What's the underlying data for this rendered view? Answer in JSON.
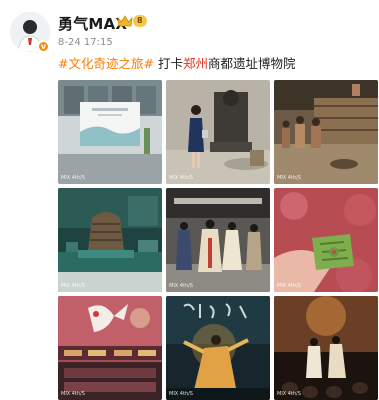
{
  "post": {
    "username": "勇气MAX",
    "level": "8",
    "timestamp": "8-24 17:15",
    "caption": {
      "tag": "#文化奇迹之旅#",
      "pre": "打卡",
      "city": "郑州",
      "post": "商都遗址博物院"
    }
  },
  "photos": [
    {
      "subject": "museum-entrance-banner",
      "watermark": "MIX 4th/S"
    },
    {
      "subject": "woman-with-bronze-statue",
      "watermark": "MIX 4th/S"
    },
    {
      "subject": "ancient-figures-diorama",
      "watermark": "MIX 4th/S"
    },
    {
      "subject": "bronze-artifact-display",
      "watermark": "MIX 4th/S"
    },
    {
      "subject": "costumed-performers-hall",
      "watermark": "MIX 4th/S"
    },
    {
      "subject": "jade-bi-disc-in-hand",
      "watermark": "MIX 4th/S"
    },
    {
      "subject": "crane-mural-exhibit",
      "watermark": "MIX 4th/S"
    },
    {
      "subject": "dance-performance-calligraphy",
      "watermark": "MIX 4th/S"
    },
    {
      "subject": "stage-performers",
      "watermark": "MIX 4th/S"
    }
  ],
  "colors": {
    "tag": "#ff7a00",
    "city": "#e0311f",
    "level_badge": "#f2c94c"
  }
}
